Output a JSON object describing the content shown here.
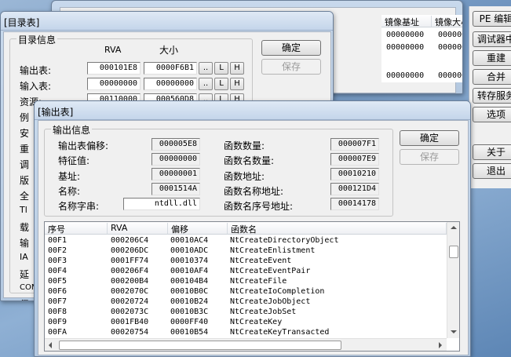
{
  "main_window": {
    "header_cols": [
      "镜像基址",
      "镜像大小"
    ],
    "header_faint": "PE",
    "rows": [
      [
        "00000000",
        "00000000"
      ],
      [
        "00000000",
        "00000000"
      ],
      [
        "00000000",
        "00000000"
      ]
    ]
  },
  "right_panel": {
    "buttons": [
      "PE 编辑",
      "调试器中",
      "重建",
      "合并",
      "转存服务",
      "选项",
      "关于",
      "退出"
    ]
  },
  "dir_window": {
    "title": "[目录表]",
    "group_title": "目录信息",
    "col_rva": "RVA",
    "col_size": "大小",
    "ok": "确定",
    "save": "保存",
    "entries": [
      {
        "label": "输出表:",
        "rva": "000101E8",
        "size": "0000F6B1"
      },
      {
        "label": "输入表:",
        "rva": "00000000",
        "size": "00000000"
      },
      {
        "label": "资源:",
        "rva": "00110000",
        "size": "000560D8"
      }
    ],
    "partial_labels": [
      "例",
      "安",
      "重",
      "调",
      "版",
      "全",
      "Tl",
      "载",
      "输",
      "IA",
      "延",
      "COM",
      "保"
    ],
    "btn_dots": "..",
    "btn_l": "L",
    "btn_h": "H"
  },
  "export_window": {
    "title": "[输出表]",
    "group_title": "输出信息",
    "ok": "确定",
    "save": "保存",
    "left_fields": [
      {
        "label": "输出表偏移:",
        "value": "000005E8"
      },
      {
        "label": "特征值:",
        "value": "00000000"
      },
      {
        "label": "基址:",
        "value": "00000001"
      },
      {
        "label": "名称:",
        "value": "0001514A"
      },
      {
        "label": "名称字串:",
        "value": "ntdll.dll"
      }
    ],
    "right_fields": [
      {
        "label": "函数数量:",
        "value": "000007F1"
      },
      {
        "label": "函数名数量:",
        "value": "000007E9"
      },
      {
        "label": "函数地址:",
        "value": "00010210"
      },
      {
        "label": "函数名称地址:",
        "value": "000121D4"
      },
      {
        "label": "函数名序号地址:",
        "value": "00014178"
      }
    ],
    "table": {
      "columns": [
        "序号",
        "RVA",
        "偏移",
        "函数名"
      ],
      "rows": [
        [
          "00F1",
          "000206C4",
          "00010AC4",
          "NtCreateDirectoryObject"
        ],
        [
          "00F2",
          "000206DC",
          "00010ADC",
          "NtCreateEnlistment"
        ],
        [
          "00F3",
          "0001FF74",
          "00010374",
          "NtCreateEvent"
        ],
        [
          "00F4",
          "000206F4",
          "00010AF4",
          "NtCreateEventPair"
        ],
        [
          "00F5",
          "000200B4",
          "000104B4",
          "NtCreateFile"
        ],
        [
          "00F6",
          "0002070C",
          "00010B0C",
          "NtCreateIoCompletion"
        ],
        [
          "00F7",
          "00020724",
          "00010B24",
          "NtCreateJobObject"
        ],
        [
          "00F8",
          "0002073C",
          "00010B3C",
          "NtCreateJobSet"
        ],
        [
          "00F9",
          "0001FB40",
          "0000FF40",
          "NtCreateKey"
        ],
        [
          "00FA",
          "00020754",
          "00010B54",
          "NtCreateKeyTransacted"
        ]
      ]
    }
  }
}
